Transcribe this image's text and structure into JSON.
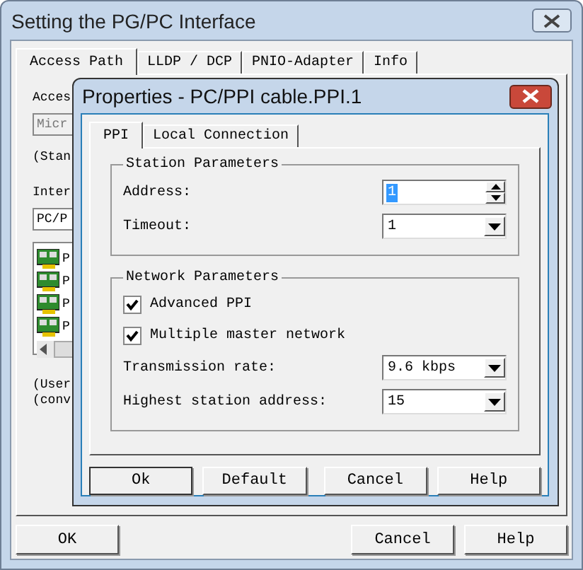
{
  "window": {
    "title": "Setting the PG/PC Interface"
  },
  "tabs": [
    {
      "label": "Access Path",
      "selected": true
    },
    {
      "label": "LLDP / DCP",
      "selected": false
    },
    {
      "label": "PNIO-Adapter",
      "selected": false
    },
    {
      "label": "Info",
      "selected": false
    }
  ],
  "access_path": {
    "access_label": "Acces",
    "access_field": "Micr",
    "access_note": "(Stan",
    "interface_label": "Inter",
    "interface_field": "PC/P",
    "interfaces": [
      {
        "label": "P"
      },
      {
        "label": "P"
      },
      {
        "label": "P"
      },
      {
        "label": "P"
      }
    ],
    "notes": [
      "(User",
      "(conv"
    ]
  },
  "buttons": [
    "OK",
    "Cancel",
    "Help"
  ],
  "dialog": {
    "title": "Properties - PC/PPI cable.PPI.1",
    "tabs": [
      {
        "label": "PPI",
        "selected": true
      },
      {
        "label": "Local Connection",
        "selected": false
      }
    ],
    "groups": [
      {
        "title": "Station Parameters",
        "items": [
          {
            "kind": "spin",
            "label": "Address:",
            "value": "1",
            "highlighted": true
          },
          {
            "kind": "dropdown",
            "label": "Timeout:",
            "value": "1"
          }
        ]
      },
      {
        "title": "Network Parameters",
        "items": [
          {
            "kind": "checkbox",
            "label": "Advanced PPI",
            "checked": true
          },
          {
            "kind": "checkbox",
            "label": "Multiple master network",
            "checked": true
          },
          {
            "kind": "dropdown",
            "label": "Transmission rate:",
            "value": "9.6 kbps"
          },
          {
            "kind": "dropdown",
            "label": "Highest station address:",
            "value": "15"
          }
        ]
      }
    ],
    "buttons": [
      "Ok",
      "Default",
      "Cancel",
      "Help"
    ]
  }
}
